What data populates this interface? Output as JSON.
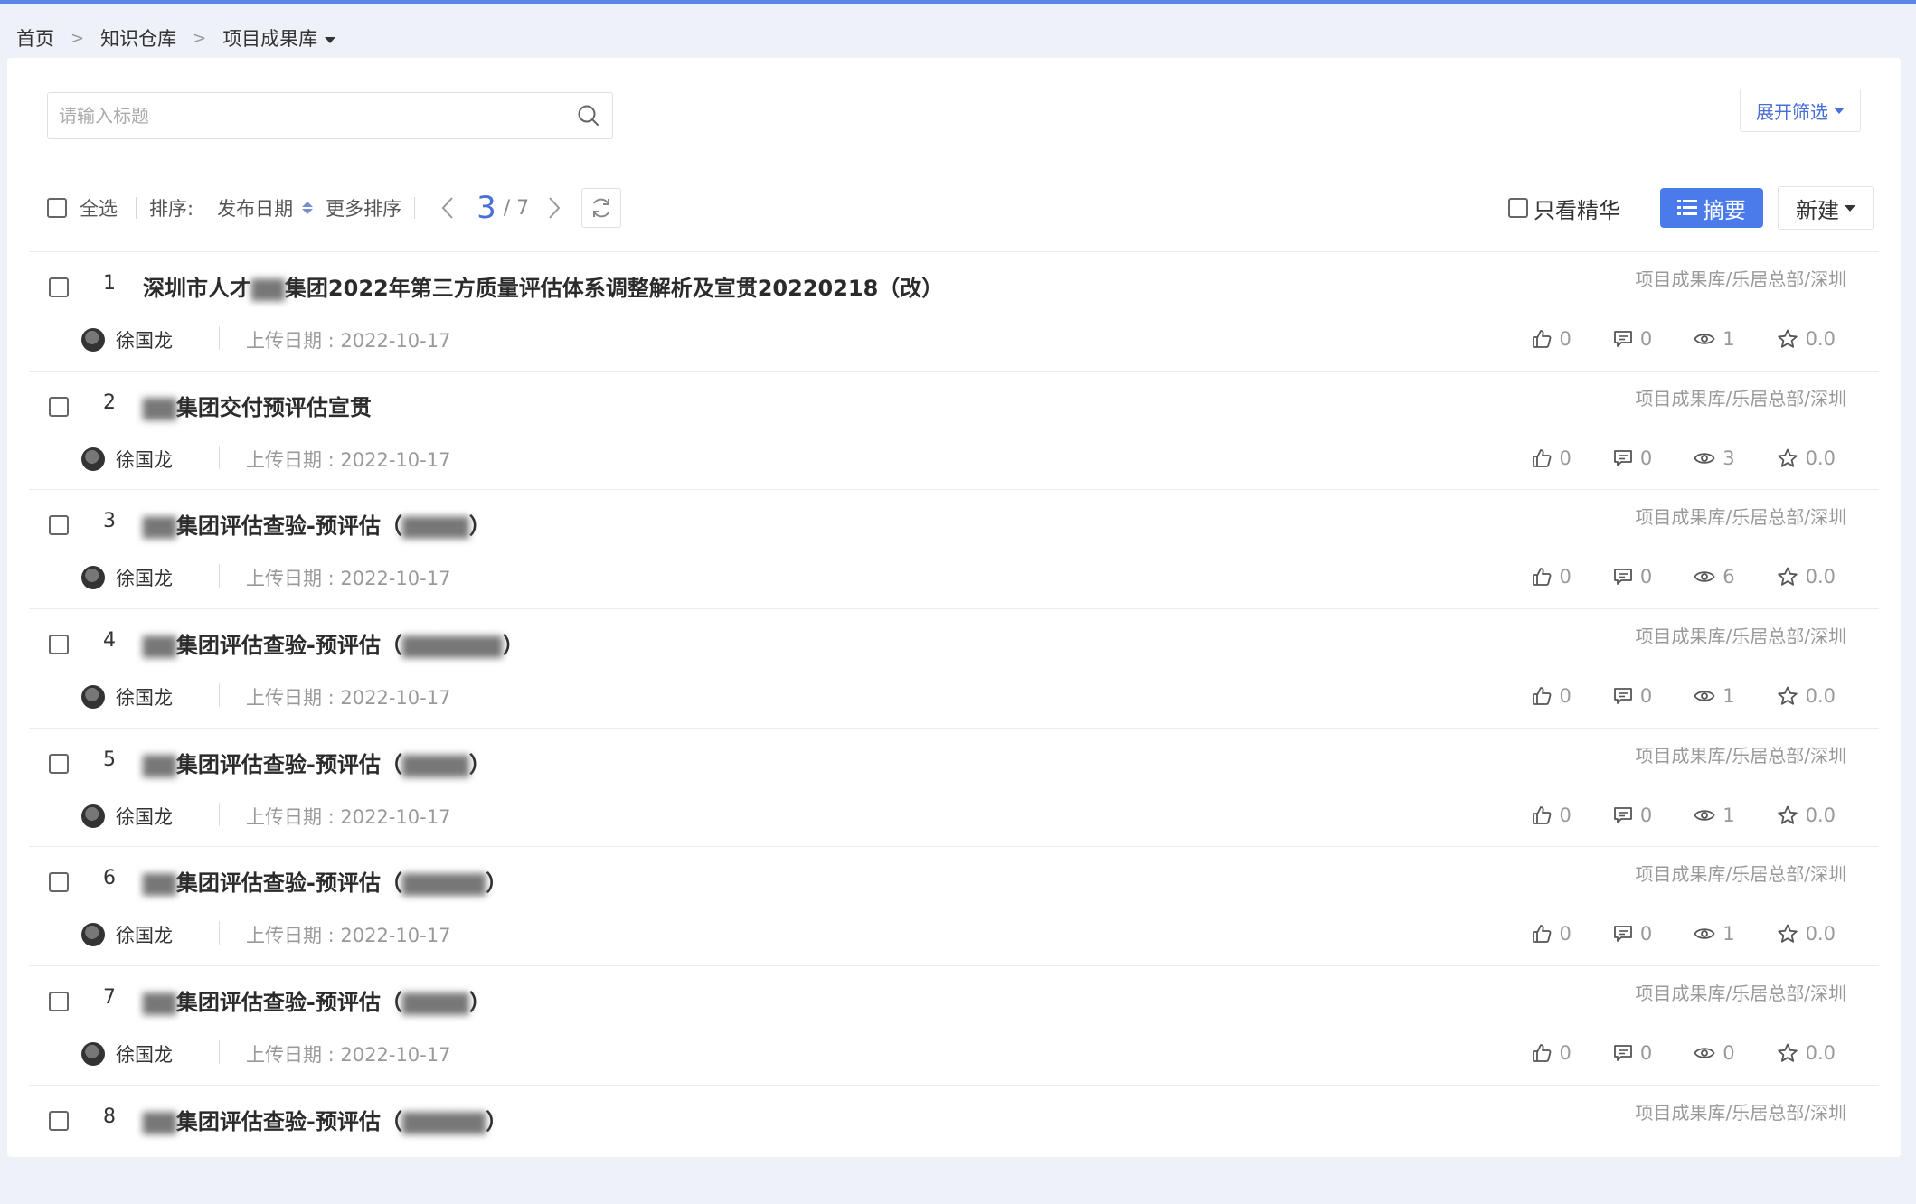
{
  "breadcrumb": {
    "home": "首页",
    "repo": "知识仓库",
    "current": "项目成果库"
  },
  "search": {
    "placeholder": "请输入标题"
  },
  "filter": {
    "label": "展开筛选"
  },
  "toolbar": {
    "select_all": "全选",
    "sort_label": "排序:",
    "sort_key": "发布日期",
    "more_sort": "更多排序",
    "page_current": "3",
    "page_total": "/ 7",
    "essence_only": "只看精华",
    "summary_label": "摘要",
    "new_label": "新建"
  },
  "items": [
    {
      "num": "1",
      "title": "深圳市人才▇▇集团2022年第三方质量评估体系调整解析及宣贯20220218（改）",
      "path": "项目成果库/乐居总部/深圳",
      "author": "徐国龙",
      "upload": "上传日期 : 2022-10-17",
      "likes": "0",
      "comments": "0",
      "views": "1",
      "rating": "0.0"
    },
    {
      "num": "2",
      "title": "▇▇集团交付预评估宣贯",
      "path": "项目成果库/乐居总部/深圳",
      "author": "徐国龙",
      "upload": "上传日期 : 2022-10-17",
      "likes": "0",
      "comments": "0",
      "views": "3",
      "rating": "0.0"
    },
    {
      "num": "3",
      "title": "▇▇集团评估查验-预评估（▇▇▇▇）",
      "path": "项目成果库/乐居总部/深圳",
      "author": "徐国龙",
      "upload": "上传日期 : 2022-10-17",
      "likes": "0",
      "comments": "0",
      "views": "6",
      "rating": "0.0"
    },
    {
      "num": "4",
      "title": "▇▇集团评估查验-预评估（▇▇▇▇▇▇）",
      "path": "项目成果库/乐居总部/深圳",
      "author": "徐国龙",
      "upload": "上传日期 : 2022-10-17",
      "likes": "0",
      "comments": "0",
      "views": "1",
      "rating": "0.0"
    },
    {
      "num": "5",
      "title": "▇▇集团评估查验-预评估（▇▇▇▇）",
      "path": "项目成果库/乐居总部/深圳",
      "author": "徐国龙",
      "upload": "上传日期 : 2022-10-17",
      "likes": "0",
      "comments": "0",
      "views": "1",
      "rating": "0.0"
    },
    {
      "num": "6",
      "title": "▇▇集团评估查验-预评估（▇▇▇▇▇）",
      "path": "项目成果库/乐居总部/深圳",
      "author": "徐国龙",
      "upload": "上传日期 : 2022-10-17",
      "likes": "0",
      "comments": "0",
      "views": "1",
      "rating": "0.0"
    },
    {
      "num": "7",
      "title": "▇▇集团评估查验-预评估（▇▇▇▇）",
      "path": "项目成果库/乐居总部/深圳",
      "author": "徐国龙",
      "upload": "上传日期 : 2022-10-17",
      "likes": "0",
      "comments": "0",
      "views": "0",
      "rating": "0.0"
    },
    {
      "num": "8",
      "title": "▇▇集团评估查验-预评估（▇▇▇▇▇）",
      "path": "项目成果库/乐居总部/深圳",
      "author": "",
      "upload": "",
      "likes": "",
      "comments": "",
      "views": "",
      "rating": ""
    }
  ],
  "colors": {
    "accent": "#4b7bea",
    "link": "#4a6fd8",
    "muted": "#999999"
  },
  "icons": [
    "search-icon",
    "chevron-left-icon",
    "chevron-right-icon",
    "refresh-icon",
    "list-icon",
    "thumbs-up-icon",
    "comment-icon",
    "eye-icon",
    "star-icon",
    "avatar"
  ]
}
